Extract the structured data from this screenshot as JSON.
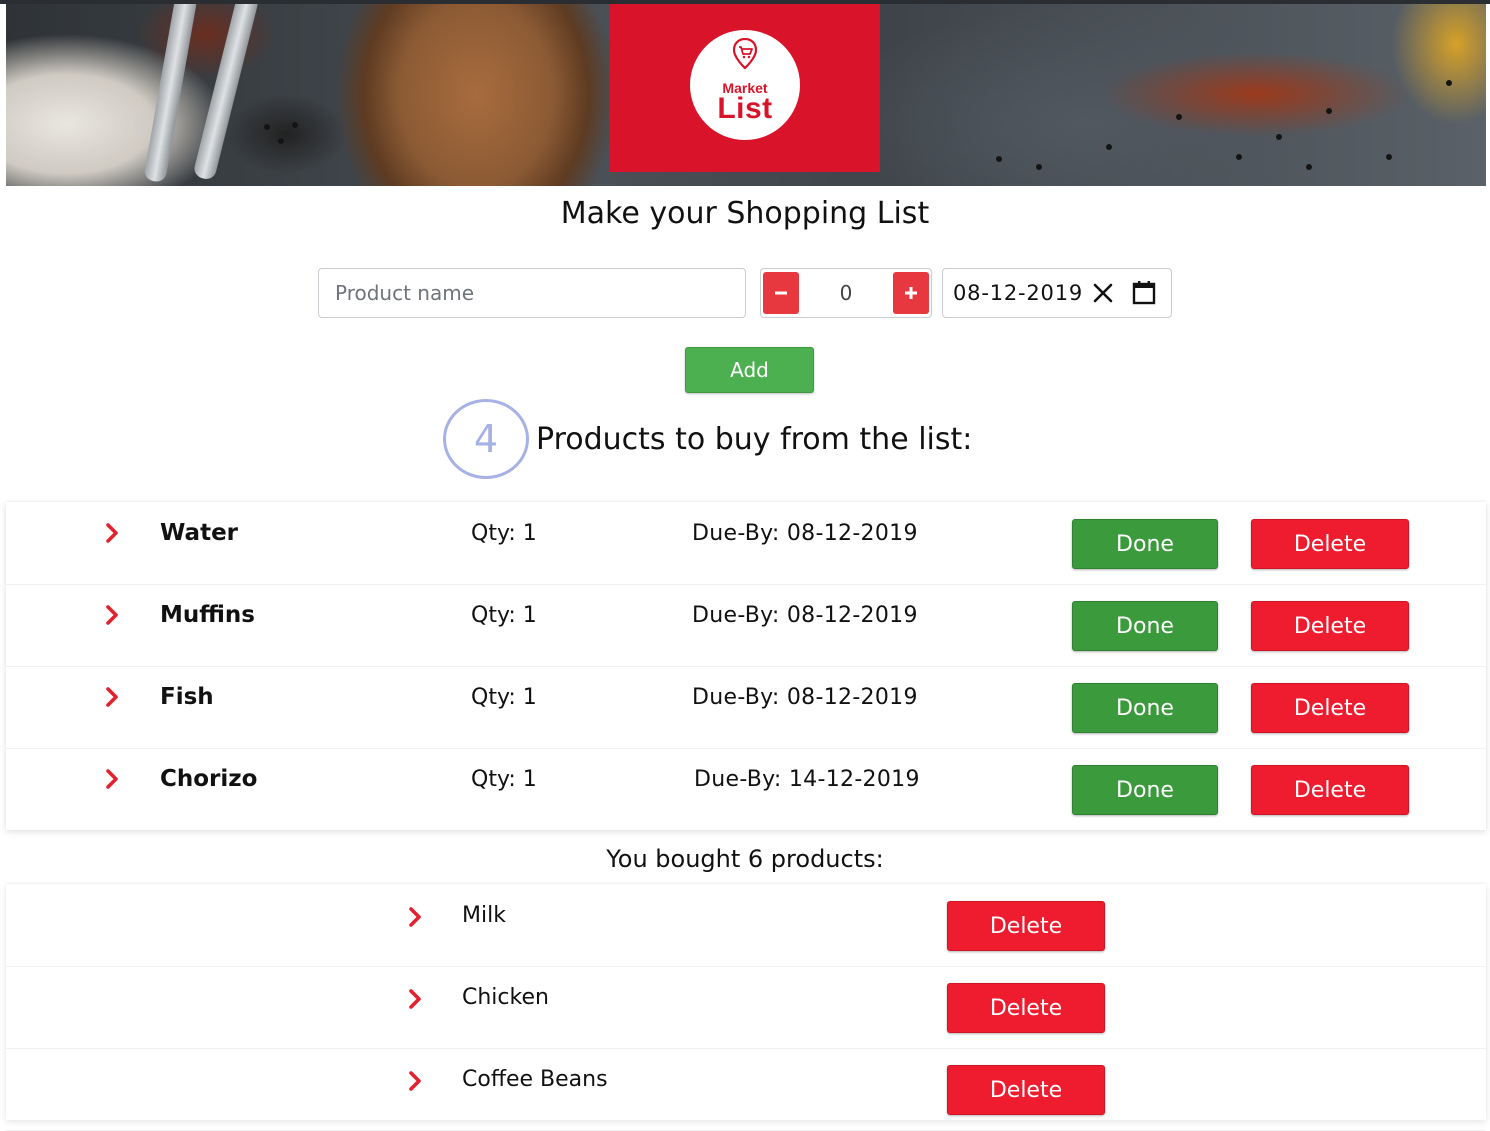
{
  "brand": {
    "logo_line1": "Market",
    "logo_line2": "List",
    "logo_color": "#d9142a"
  },
  "page_title": "Make your Shopping List",
  "form": {
    "product_placeholder": "Product name",
    "product_value": "",
    "quantity_value": "0",
    "minus_label": "−",
    "plus_label": "+",
    "date_value": "08-12-2019",
    "add_label": "Add"
  },
  "pending": {
    "count": "4",
    "heading": "Products to buy from the list:",
    "items": [
      {
        "name": "Water",
        "qty": "Qty: 1",
        "due": "Due-By: 08-12-2019",
        "done_label": "Done",
        "delete_label": "Delete"
      },
      {
        "name": "Muffins",
        "qty": "Qty: 1",
        "due": "Due-By: 08-12-2019",
        "done_label": "Done",
        "delete_label": "Delete"
      },
      {
        "name": "Fish",
        "qty": "Qty: 1",
        "due": "Due-By: 08-12-2019",
        "done_label": "Done",
        "delete_label": "Delete"
      },
      {
        "name": "Chorizo",
        "qty": "Qty: 1",
        "due": "Due-By: 14-12-2019",
        "done_label": "Done",
        "delete_label": "Delete"
      }
    ]
  },
  "bought": {
    "heading": "You bought 6 products:",
    "items": [
      {
        "name": "Milk",
        "delete_label": "Delete"
      },
      {
        "name": "Chicken",
        "delete_label": "Delete"
      },
      {
        "name": "Coffee Beans",
        "delete_label": "Delete"
      }
    ]
  },
  "colors": {
    "accent_red": "#ee1c2e",
    "done_green": "#3b9a3c",
    "add_green": "#4caf50",
    "counter_blue": "#a6b2e6"
  },
  "icons": {
    "chevron": "chevron-right-icon",
    "clear": "close-icon",
    "calendar": "calendar-icon",
    "logo_pin": "map-pin-cart-icon"
  }
}
